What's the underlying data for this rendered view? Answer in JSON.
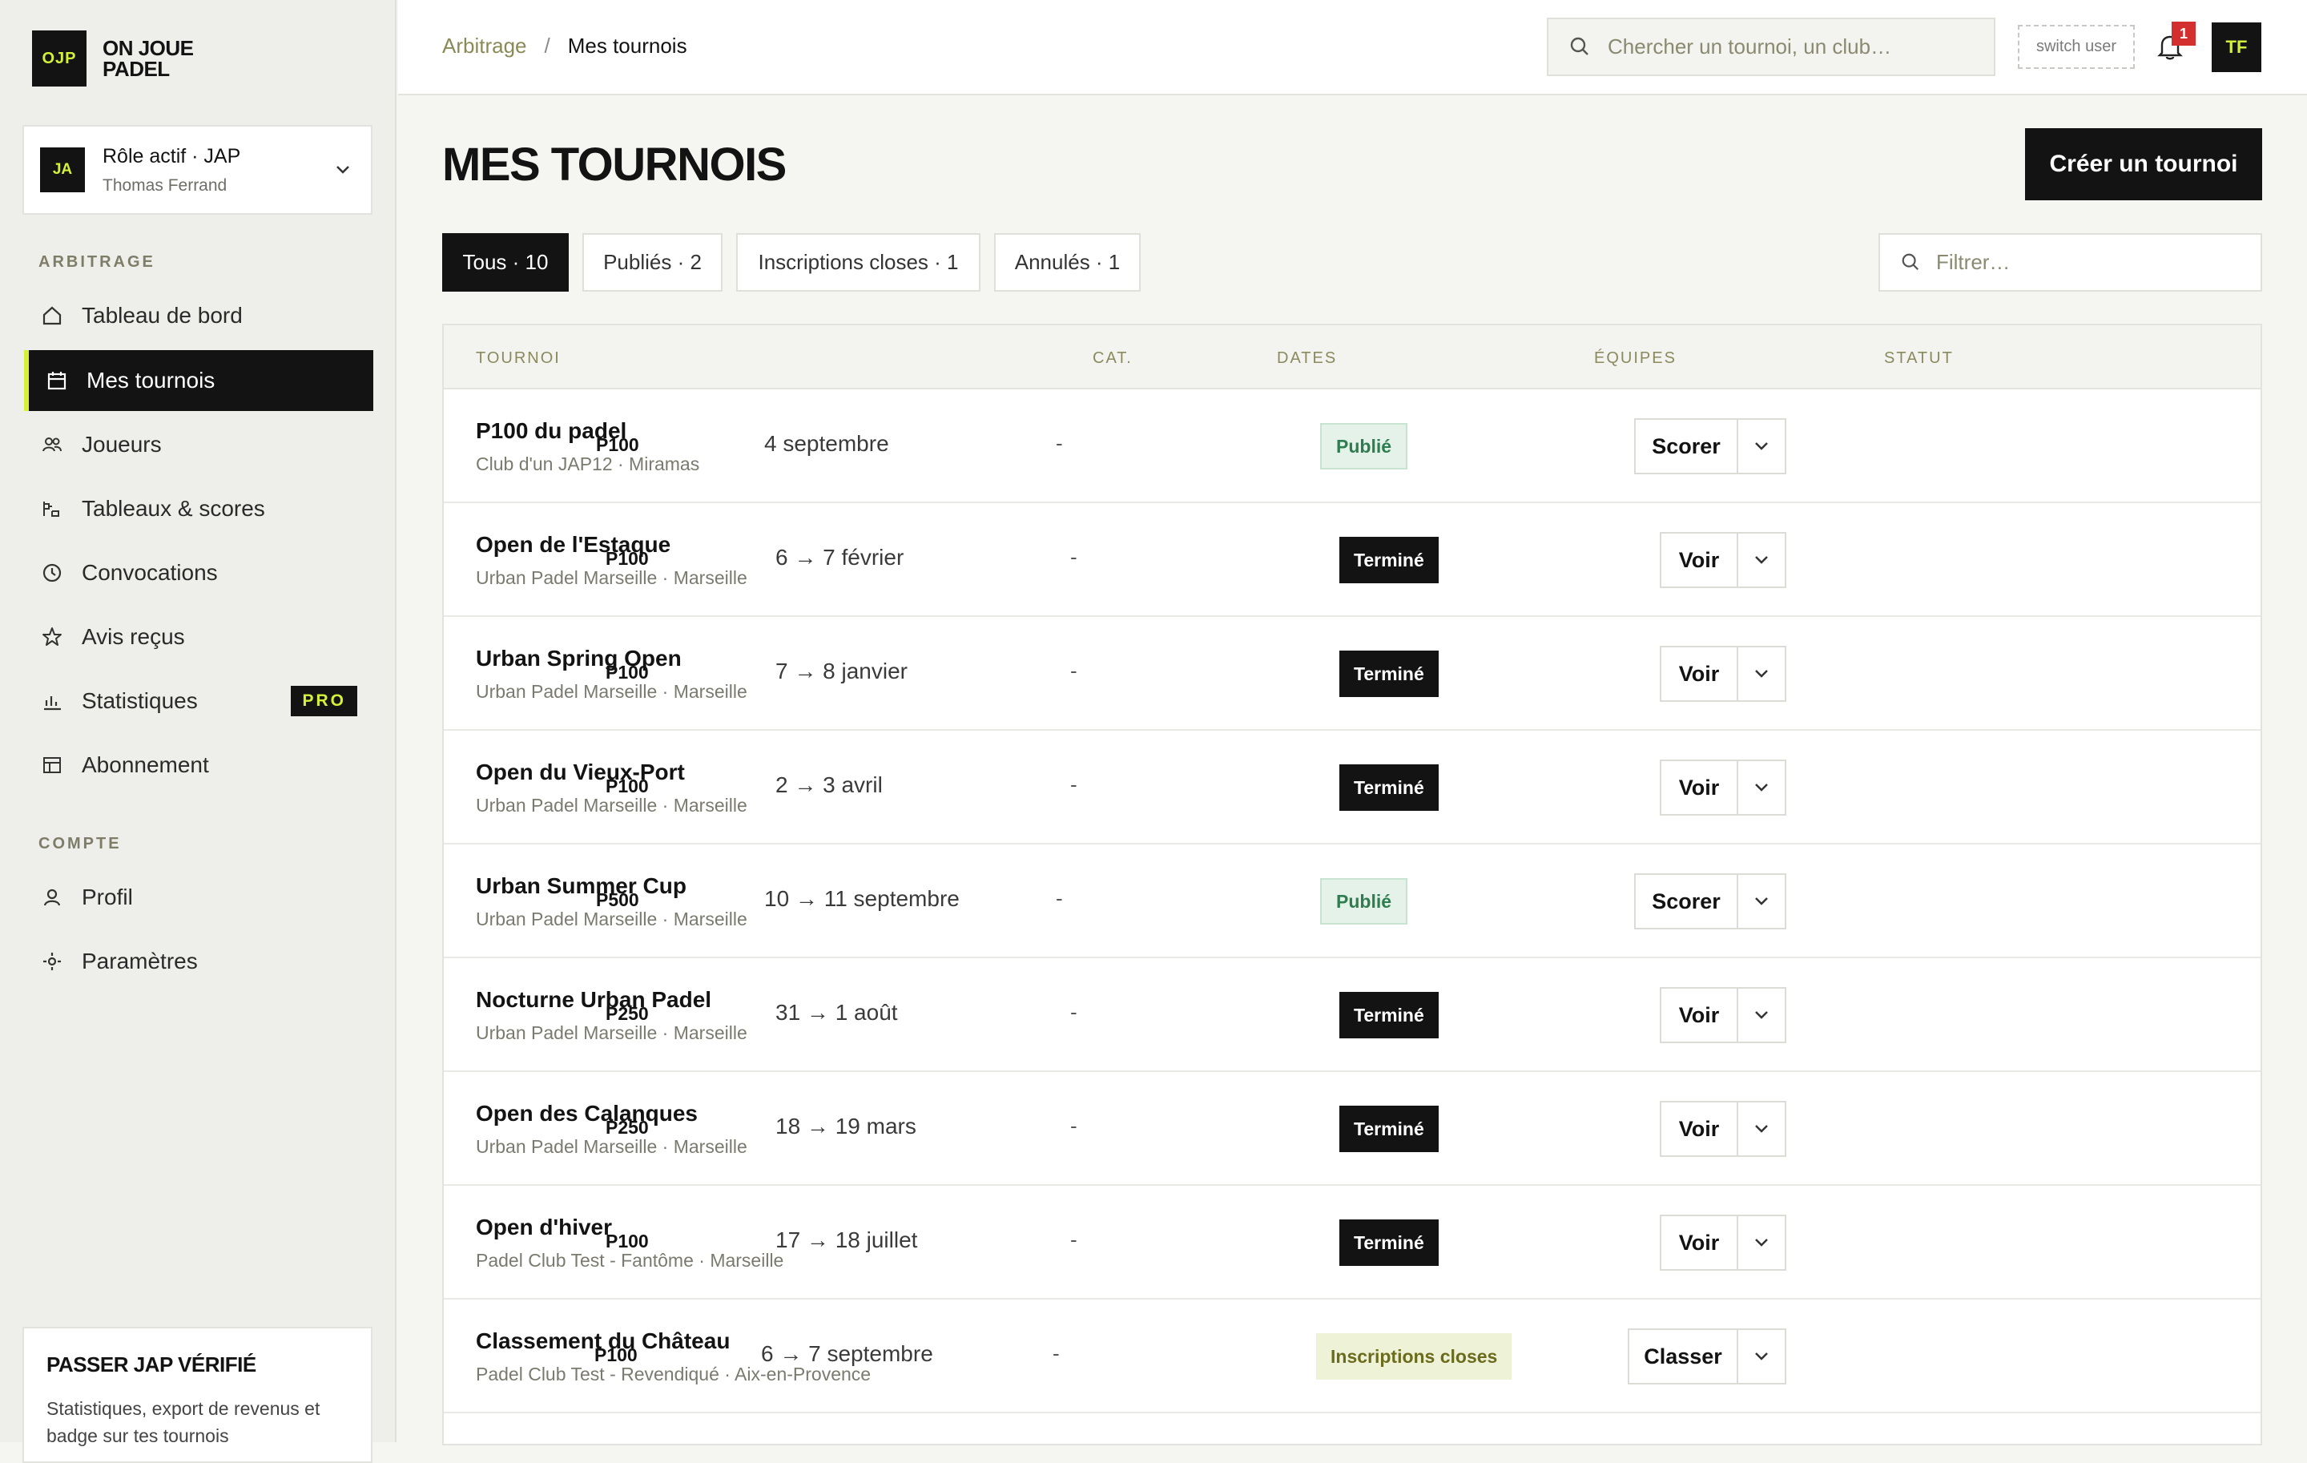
{
  "brand": {
    "mark": "OJP",
    "name": "ON JOUE PADEL"
  },
  "role": {
    "avatar": "JA",
    "title": "Rôle actif · JAP",
    "user": "Thomas Ferrand"
  },
  "sidebar": {
    "section_arbitrage": "ARBITRAGE",
    "section_compte": "COMPTE",
    "items": [
      {
        "label": "Tableau de bord",
        "icon": "home-icon"
      },
      {
        "label": "Mes tournois",
        "icon": "calendar-icon",
        "active": true
      },
      {
        "label": "Joueurs",
        "icon": "users-icon"
      },
      {
        "label": "Tableaux & scores",
        "icon": "bracket-icon"
      },
      {
        "label": "Convocations",
        "icon": "clock-icon"
      },
      {
        "label": "Avis reçus",
        "icon": "star-icon"
      },
      {
        "label": "Statistiques",
        "icon": "bar-chart-icon",
        "badge": "PRO"
      },
      {
        "label": "Abonnement",
        "icon": "subscription-icon"
      }
    ],
    "account_items": [
      {
        "label": "Profil",
        "icon": "user-icon"
      },
      {
        "label": "Paramètres",
        "icon": "settings-icon"
      }
    ],
    "upsell": {
      "title": "PASSER JAP VÉRIFIÉ",
      "text": "Statistiques, export de revenus et badge sur tes tournois"
    }
  },
  "topbar": {
    "breadcrumb_parent": "Arbitrage",
    "breadcrumb_sep": "/",
    "breadcrumb_current": "Mes tournois",
    "search_placeholder": "Chercher un tournoi, un club…",
    "switch_user": "switch user",
    "notifications_count": "1",
    "user_initials": "TF"
  },
  "main": {
    "title": "MES TOURNOIS",
    "create_button": "Créer un tournoi",
    "filter_placeholder": "Filtrer…",
    "tabs": [
      {
        "label": "Tous · 10",
        "active": true
      },
      {
        "label": "Publiés · 2"
      },
      {
        "label": "Inscriptions closes · 1"
      },
      {
        "label": "Annulés · 1"
      }
    ],
    "columns": [
      "TOURNOI",
      "CAT.",
      "DATES",
      "ÉQUIPES",
      "STATUT"
    ],
    "rows": [
      {
        "name": "P100 du padel",
        "club": "Club d'un JAP12 · Miramas",
        "cat": "P100",
        "dates": "4 septembre",
        "teams": "-",
        "status": "Publié",
        "status_kind": "published",
        "action": "Scorer"
      },
      {
        "name": "Open de l'Estaque",
        "club": "Urban Padel Marseille · Marseille",
        "cat": "P100",
        "dates": "6 → 7 février",
        "teams": "-",
        "status": "Terminé",
        "status_kind": "done",
        "action": "Voir"
      },
      {
        "name": "Urban Spring Open",
        "club": "Urban Padel Marseille · Marseille",
        "cat": "P100",
        "dates": "7 → 8 janvier",
        "teams": "-",
        "status": "Terminé",
        "status_kind": "done",
        "action": "Voir"
      },
      {
        "name": "Open du Vieux-Port",
        "club": "Urban Padel Marseille · Marseille",
        "cat": "P100",
        "dates": "2 → 3 avril",
        "teams": "-",
        "status": "Terminé",
        "status_kind": "done",
        "action": "Voir"
      },
      {
        "name": "Urban Summer Cup",
        "club": "Urban Padel Marseille · Marseille",
        "cat": "P500",
        "dates": "10 → 11 septembre",
        "teams": "-",
        "status": "Publié",
        "status_kind": "published",
        "action": "Scorer"
      },
      {
        "name": "Nocturne Urban Padel",
        "club": "Urban Padel Marseille · Marseille",
        "cat": "P250",
        "dates": "31 → 1 août",
        "teams": "-",
        "status": "Terminé",
        "status_kind": "done",
        "action": "Voir"
      },
      {
        "name": "Open des Calanques",
        "club": "Urban Padel Marseille · Marseille",
        "cat": "P250",
        "dates": "18 → 19 mars",
        "teams": "-",
        "status": "Terminé",
        "status_kind": "done",
        "action": "Voir"
      },
      {
        "name": "Open d'hiver",
        "club": "Padel Club Test - Fantôme · Marseille",
        "cat": "P100",
        "dates": "17 → 18 juillet",
        "teams": "-",
        "status": "Terminé",
        "status_kind": "done",
        "action": "Voir"
      },
      {
        "name": "Classement du Château",
        "club": "Padel Club Test - Revendiqué · Aix-en-Provence",
        "cat": "P100",
        "dates": "6 → 7 septembre",
        "teams": "-",
        "status": "Inscriptions closes",
        "status_kind": "closed",
        "action": "Classer"
      }
    ]
  },
  "colors": {
    "accent": "#d6f03a",
    "dark": "#131313",
    "published": "#2e7d4f",
    "alert": "#d32f2f"
  }
}
